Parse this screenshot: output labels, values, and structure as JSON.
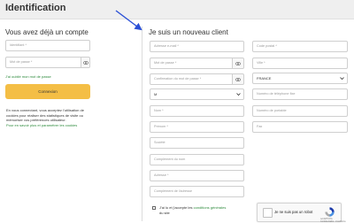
{
  "page": {
    "title": "Identification"
  },
  "login": {
    "heading": "Vous avez déjà un compte",
    "id_placeholder": "Identifiant *",
    "password_placeholder": "Mot de passe *",
    "forgot_link": "J'ai oublié mon mot de passe",
    "submit_label": "Connexion",
    "cookies_text": "En vous connectant, vous acceptez l'utilisation de cookies pour réaliser des statistiques de visite ou mémoriser vos préférences utilisateur.",
    "cookies_link": "Pour en savoir plus et paramétrer les cookies"
  },
  "register": {
    "heading": "Je suis un nouveau client",
    "email_placeholder": "Adresse e-mail *",
    "password_placeholder": "Mot de passe *",
    "confirm_placeholder": "Confirmation du mot de passe *",
    "civility_value": "M",
    "lastname_placeholder": "Nom *",
    "firstname_placeholder": "Prénom *",
    "company_placeholder": "Société",
    "name_complement_placeholder": "Complément du nom",
    "address_placeholder": "Adresse *",
    "address_complement_placeholder": "Complément de l'adresse",
    "postal_placeholder": "Code postal *",
    "city_placeholder": "Ville *",
    "country_value": "FRANCE",
    "phone_placeholder": "Numéro de téléphone fixe",
    "mobile_placeholder": "Numéro de portable",
    "fax_placeholder": "Fax",
    "cgv_text_before": "J'ai lu et j'accepte les",
    "cgv_link": "conditions générales",
    "cgv_text_after": "du site"
  },
  "captcha": {
    "label": "Je ne suis pas un robot",
    "brand": "reCAPTCHA",
    "terms": "Confidentialité - Conditions"
  },
  "colors": {
    "accent_button": "#f4be45",
    "link_green": "#2e8b3d",
    "arrow_blue": "#2a4fd6",
    "topbar": "#efefef"
  },
  "icons": {
    "eye": "eye-icon",
    "chevron": "chevron-down-icon",
    "checkbox": "checkbox-icon",
    "arrow": "annotation-arrow-icon"
  }
}
